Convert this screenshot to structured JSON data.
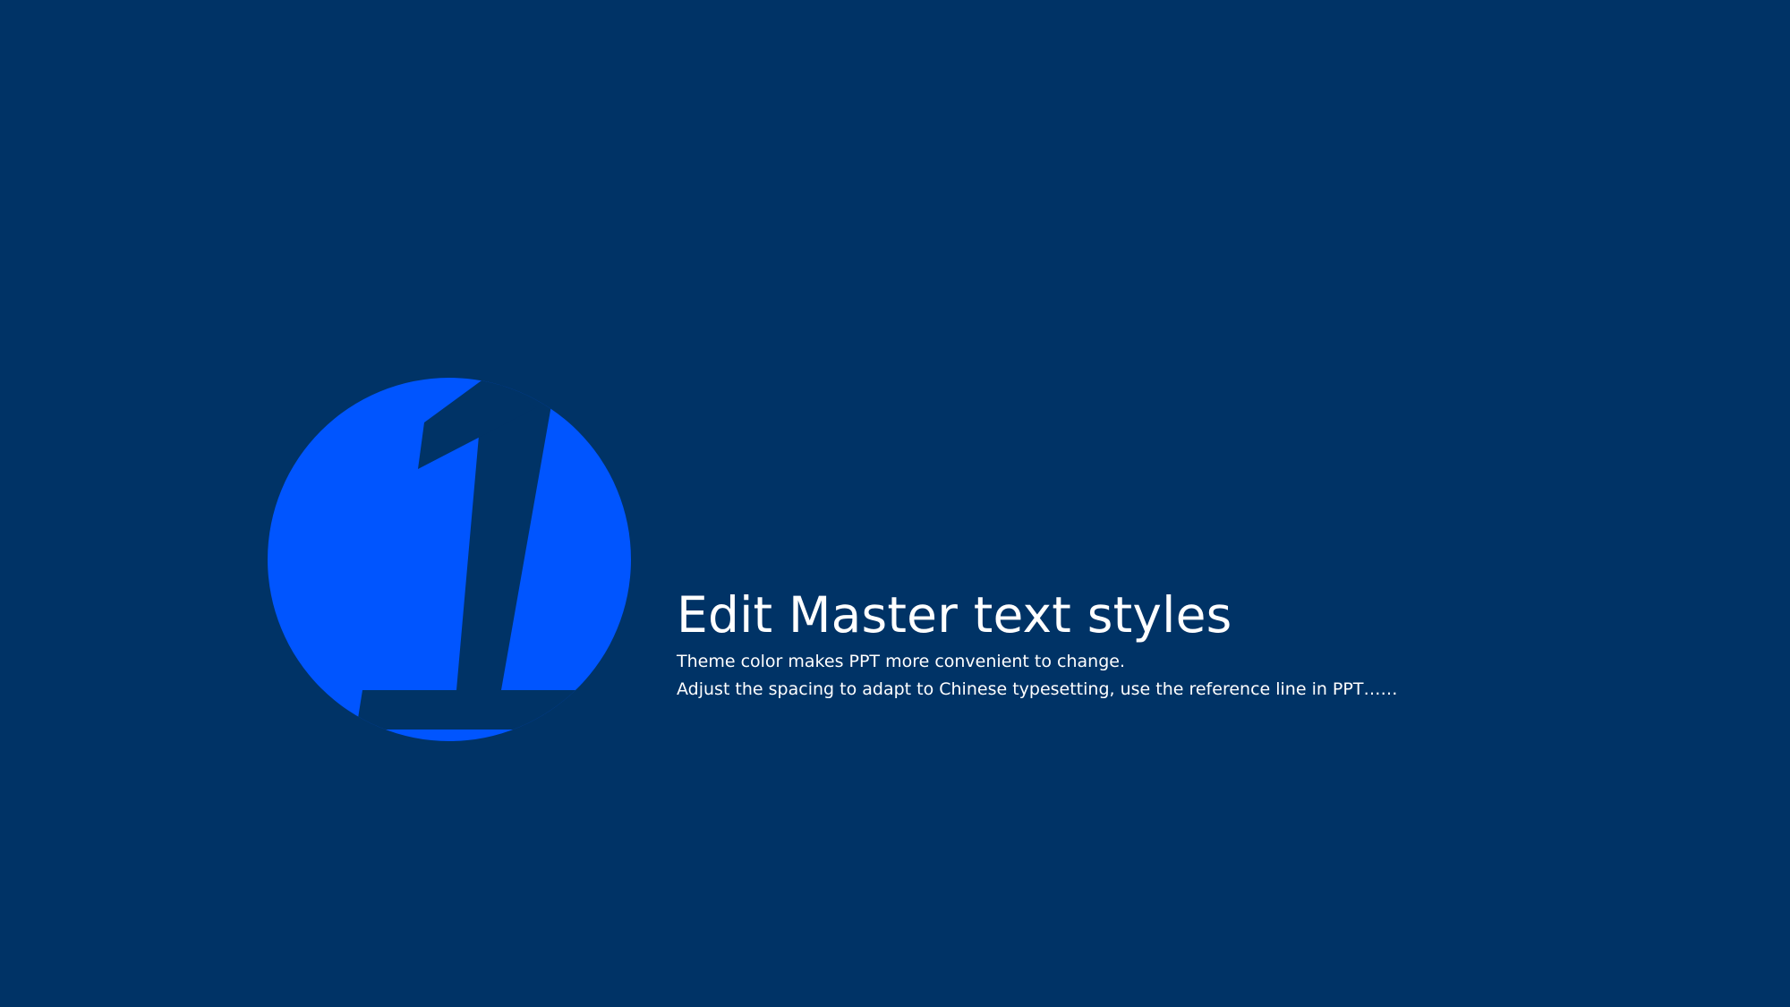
{
  "slide": {
    "title": "Edit Master text styles",
    "subtitle_lines": [
      "Theme color makes PPT more convenient to change.",
      "Adjust the spacing to adapt to Chinese typesetting, use the reference line  in PPT……"
    ]
  },
  "colors": {
    "background": "#003366",
    "accent": "#0055FF",
    "text": "#FFFFFF"
  },
  "icons": {
    "badge": "number-one-badge-icon"
  }
}
